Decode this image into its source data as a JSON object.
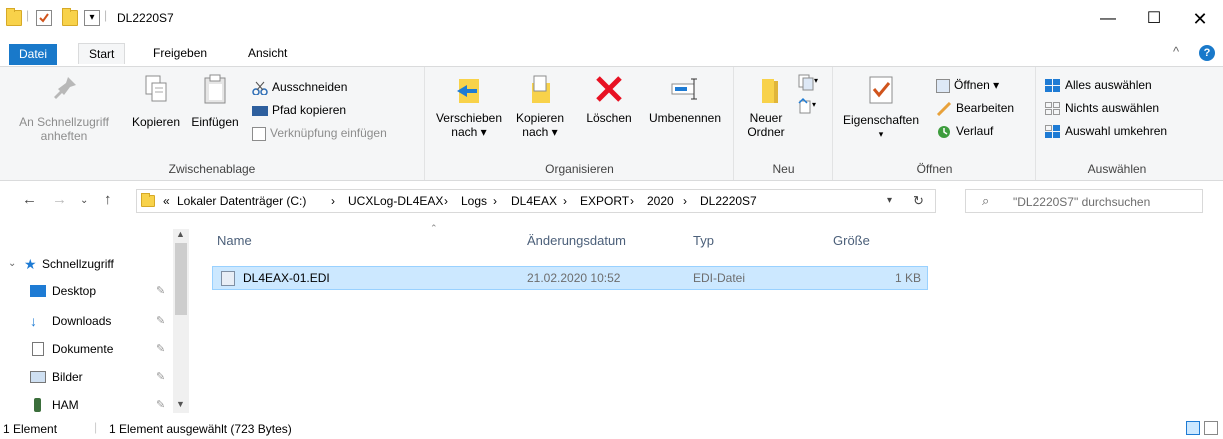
{
  "window": {
    "title": "DL2220S7"
  },
  "tabs": [
    {
      "label": "Datei"
    },
    {
      "label": "Start"
    },
    {
      "label": "Freigeben"
    },
    {
      "label": "Ansicht"
    }
  ],
  "ribbon": {
    "clipboard": {
      "label": "Zwischenablage",
      "pin_quick": "An Schnellzugriff anheften",
      "copy": "Kopieren",
      "paste": "Einfügen",
      "cut": "Ausschneiden",
      "copy_path": "Pfad kopieren",
      "paste_shortcut": "Verknüpfung einfügen"
    },
    "organize": {
      "label": "Organisieren",
      "move_to": "Verschieben nach ▾",
      "copy_to": "Kopieren nach ▾",
      "delete": "Löschen",
      "rename": "Umbenennen"
    },
    "new": {
      "label": "Neu",
      "new_folder": "Neuer Ordner"
    },
    "open": {
      "label": "Öffnen",
      "properties": "Eigenschaften",
      "open": "Öffnen ▾",
      "edit": "Bearbeiten",
      "history": "Verlauf"
    },
    "select": {
      "label": "Auswählen",
      "select_all": "Alles auswählen",
      "select_none": "Nichts auswählen",
      "invert": "Auswahl umkehren"
    }
  },
  "address": {
    "crumbs": [
      "«",
      "Lokaler Datenträger (C:)",
      "›",
      "UCXLog-DL4EAX",
      "›",
      "Logs",
      "›",
      "DL4EAX",
      "›",
      "EXPORT",
      "›",
      "2020",
      "›",
      "DL2220S7"
    ],
    "search_placeholder": "\"DL2220S7\" durchsuchen"
  },
  "navpane": {
    "items": [
      {
        "label": "Schnellzugriff"
      },
      {
        "label": "Desktop"
      },
      {
        "label": "Downloads"
      },
      {
        "label": "Dokumente"
      },
      {
        "label": "Bilder"
      },
      {
        "label": "HAM"
      }
    ]
  },
  "filelist": {
    "columns": [
      "Name",
      "Änderungsdatum",
      "Typ",
      "Größe"
    ],
    "rows": [
      {
        "name": "DL4EAX-01.EDI",
        "date": "21.02.2020 10:52",
        "type": "EDI-Datei",
        "size": "1 KB"
      }
    ]
  },
  "status": {
    "count": "1 Element",
    "selection": "1 Element ausgewählt (723 Bytes)"
  },
  "colors": {
    "accent": "#1979ca",
    "selection": "#cce8ff",
    "folder": "#f8d24a"
  }
}
